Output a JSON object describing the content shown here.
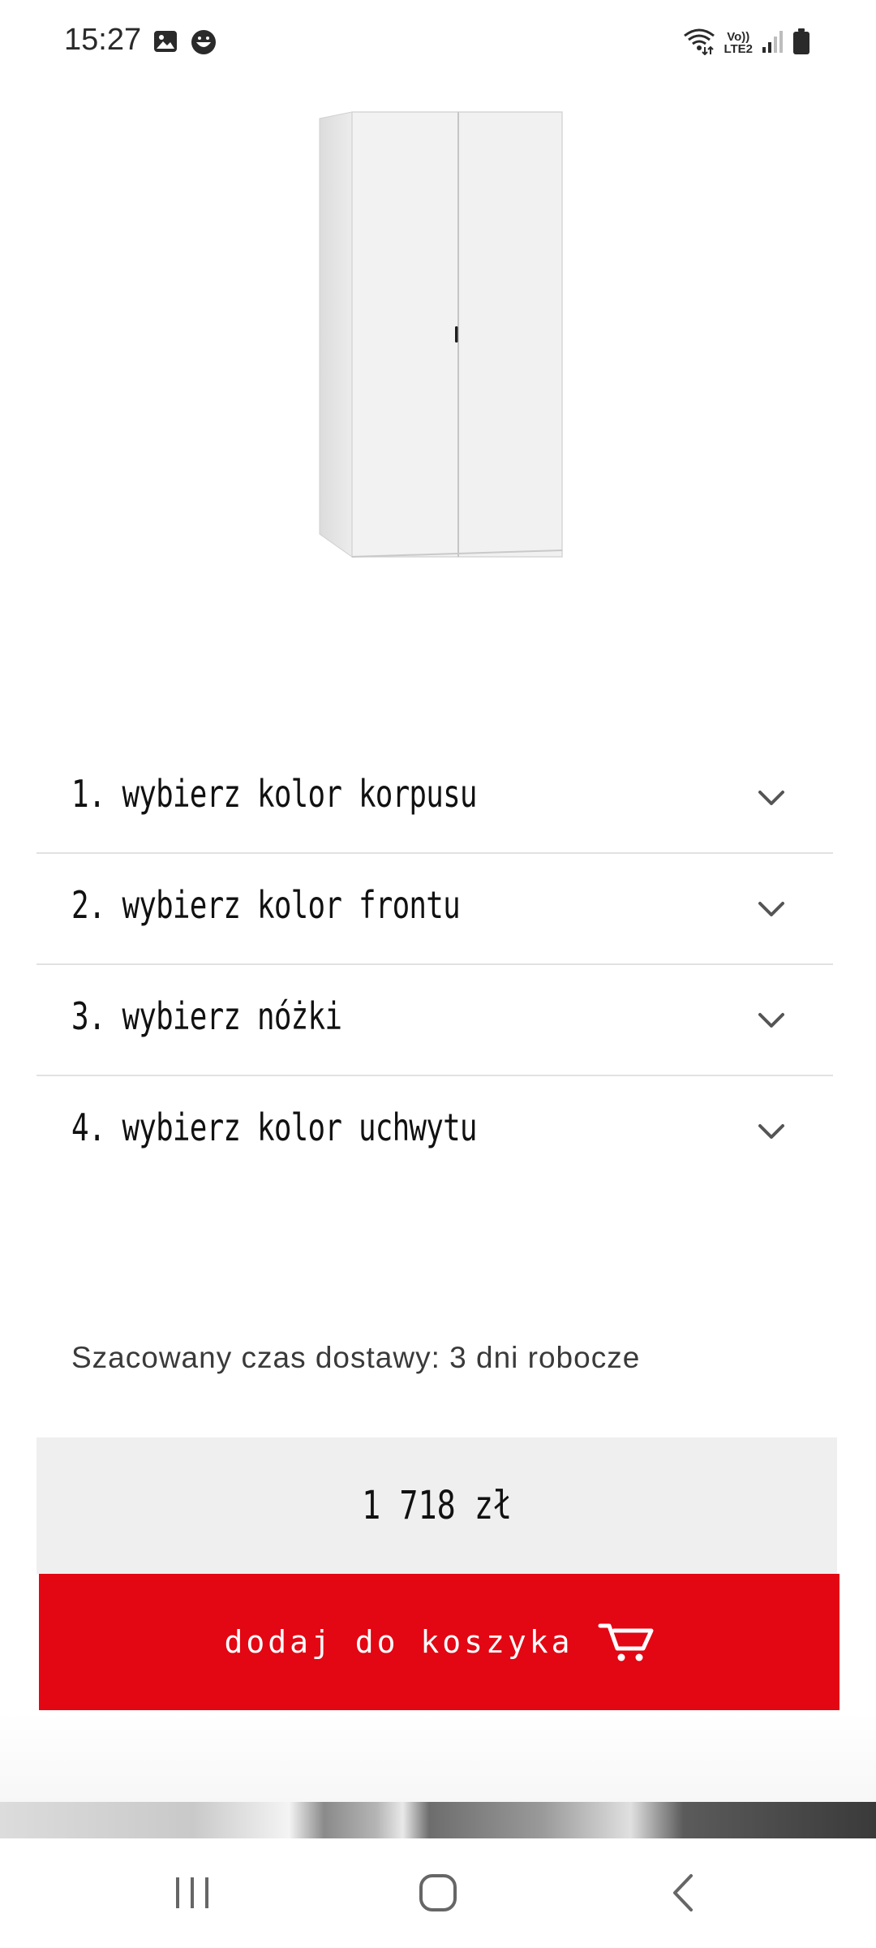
{
  "status_bar": {
    "time": "15:27",
    "left_icons": [
      "gallery-icon",
      "face-icon"
    ],
    "right_icons": [
      "wifi-icon",
      "lte-icon",
      "signal-icon",
      "battery-icon"
    ],
    "lte_top": "Vo))",
    "lte_bottom": "LTE2"
  },
  "product": {
    "image_name": "white-wardrobe-image"
  },
  "configurator": {
    "items": [
      {
        "label": "1. wybierz kolor korpusu"
      },
      {
        "label": "2. wybierz kolor frontu"
      },
      {
        "label": "3. wybierz nóżki"
      },
      {
        "label": "4. wybierz kolor uchwytu"
      }
    ]
  },
  "delivery": {
    "text": "Szacowany czas dostawy: 3 dni robocze"
  },
  "price": {
    "text": "1 718 zł"
  },
  "cart_button": {
    "label": "dodaj do koszyka",
    "icon": "cart-icon",
    "color": "#e30613"
  },
  "nav_bar": {
    "buttons": [
      "recent-apps-icon",
      "home-icon",
      "back-icon"
    ]
  }
}
